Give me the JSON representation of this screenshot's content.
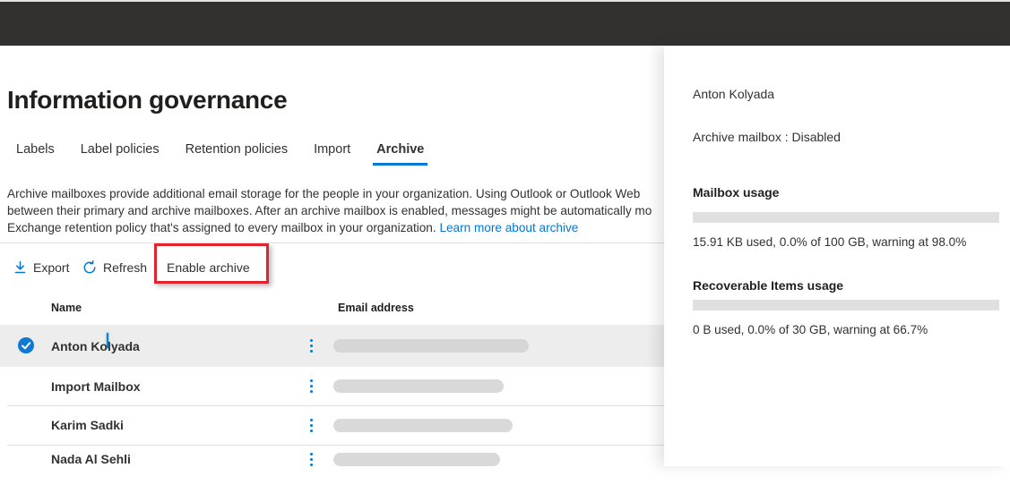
{
  "page": {
    "title": "Information governance"
  },
  "tabs": {
    "items": [
      {
        "label": "Labels",
        "active": false
      },
      {
        "label": "Label policies",
        "active": false
      },
      {
        "label": "Retention policies",
        "active": false
      },
      {
        "label": "Import",
        "active": false
      },
      {
        "label": "Archive",
        "active": true
      }
    ]
  },
  "description": {
    "line1": "Archive mailboxes provide additional email storage for the people in your organization. Using Outlook or Outlook Web",
    "line2": "between their primary and archive mailboxes. After an archive mailbox is enabled, messages might be automatically mo",
    "line3": "Exchange retention policy that's assigned to every mailbox in your organization. ",
    "link_label": "Learn more about archive"
  },
  "toolbar": {
    "export_label": "Export",
    "refresh_label": "Refresh",
    "enable_archive_label": "Enable archive",
    "icons": {
      "export": "download-arrow-icon",
      "refresh": "circular-arrow-icon"
    }
  },
  "annotation": {
    "color": "#e1232d"
  },
  "table": {
    "columns": [
      {
        "label": "Name"
      },
      {
        "label": "Email address"
      }
    ],
    "rows": [
      {
        "name": "Anton Kolyada",
        "selected": true,
        "email_redacted": true
      },
      {
        "name": "Import Mailbox",
        "selected": false,
        "email_redacted": true
      },
      {
        "name": "Karim Sadki",
        "selected": false,
        "email_redacted": true
      },
      {
        "name": "Nada Al Sehli",
        "selected": false,
        "email_redacted": true
      }
    ]
  },
  "panel": {
    "user_name": "Anton Kolyada",
    "archive_status_label": "Archive mailbox : Disabled",
    "mailbox_usage": {
      "heading": "Mailbox usage",
      "percent_used": 0.0,
      "detail": "15.91 KB used, 0.0% of 100 GB, warning at 98.0%"
    },
    "recoverable_usage": {
      "heading": "Recoverable Items usage",
      "percent_used": 0.0,
      "detail": "0 B used, 0.0% of 30 GB, warning at 66.7%"
    }
  },
  "colors": {
    "accent": "#0078d4",
    "annotation_red": "#e1232d",
    "top_bar": "#333130",
    "selected_row_bg": "#ededed",
    "redaction_pill": "#d9d9d9",
    "progress_track": "#e0e0e0",
    "text_primary": "#323130"
  }
}
